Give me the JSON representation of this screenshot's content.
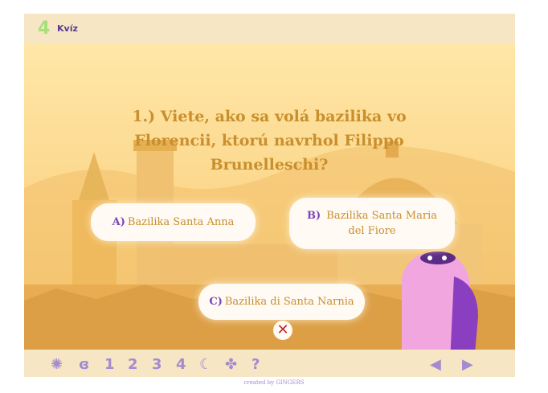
{
  "header": {
    "section_number": "4",
    "title": "Kvíz"
  },
  "quiz": {
    "question": "1.) Viete, ako sa volá bazilika vo Florencii, ktorú navrhol Filippo Brunelleschi?",
    "answers": [
      {
        "letter": "A)",
        "text": "Bazilika Santa Anna"
      },
      {
        "letter": "B)",
        "text": "Bazilika Santa Maria del Fiore"
      },
      {
        "letter": "C)",
        "text": "Bazilika di Santa Narnia"
      }
    ],
    "close_symbol": "✕"
  },
  "navigation": {
    "items": [
      "✺",
      "ɞ",
      "1",
      "2",
      "3",
      "4",
      "☾",
      "✤",
      "?"
    ],
    "prev": "◀",
    "next": "▶"
  },
  "credit": "created by GINGERS",
  "colors": {
    "accent_purple": "#7a45b6",
    "question_text": "#c98f2e",
    "header_bg": "#f6e6c4",
    "nav_icons": "#a48bd0"
  }
}
